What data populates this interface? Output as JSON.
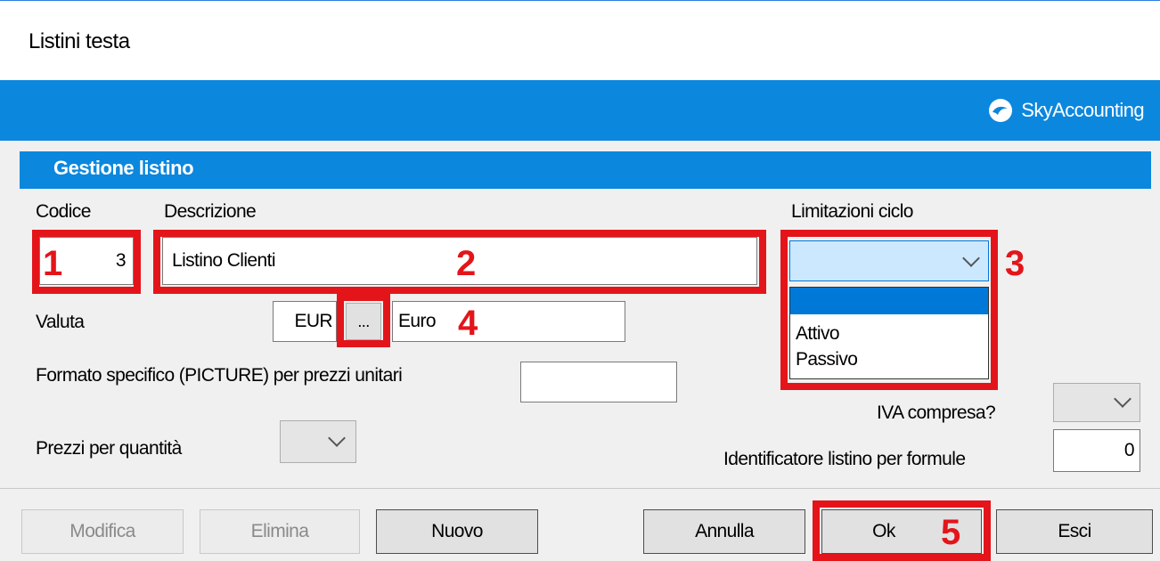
{
  "window": {
    "title": "Listini testa"
  },
  "banner": {
    "brand": "SkyAccounting"
  },
  "section": {
    "title": "Gestione listino"
  },
  "fields": {
    "codice_label": "Codice",
    "codice_value": "3",
    "descrizione_label": "Descrizione",
    "descrizione_value": "Listino Clienti",
    "limitazioni_label": "Limitazioni ciclo",
    "limitazioni_options": [
      "",
      "Attivo",
      "Passivo"
    ],
    "valuta_label": "Valuta",
    "valuta_code": "EUR",
    "valuta_browse": "...",
    "valuta_desc": "Euro",
    "picture_label": "Formato specifico (PICTURE) per prezzi unitari",
    "picture_value": "",
    "iva_label": "IVA compresa?",
    "prezzi_label": "Prezzi per quantità",
    "identificatore_label": "Identificatore listino per formule",
    "identificatore_value": "0"
  },
  "annotations": {
    "n1": "1",
    "n2": "2",
    "n3": "3",
    "n4": "4",
    "n5": "5"
  },
  "buttons": {
    "modifica": "Modifica",
    "elimina": "Elimina",
    "nuovo": "Nuovo",
    "annulla": "Annulla",
    "ok": "Ok",
    "esci": "Esci"
  },
  "colors": {
    "accent": "#0b87de",
    "highlight": "#e3151a",
    "selected": "#cce8ff"
  }
}
